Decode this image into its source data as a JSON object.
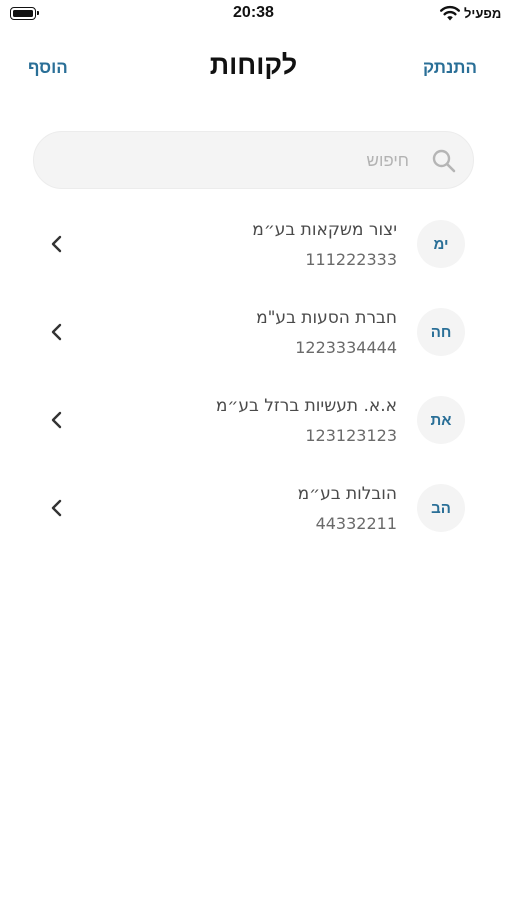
{
  "status_bar": {
    "time": "20:38",
    "carrier": "מפעיל",
    "wifi_icon": "wifi-icon",
    "battery_icon": "battery-icon"
  },
  "nav": {
    "title": "לקוחות",
    "left_action": "הוסף",
    "right_action": "התנתק"
  },
  "search": {
    "placeholder": "חיפוש",
    "value": "",
    "icon": "search-icon"
  },
  "clients": [
    {
      "initials": "ימ",
      "name": "יצור משקאות בע״מ",
      "id": "111222333"
    },
    {
      "initials": "חה",
      "name": "חברת הסעות בע\"מ",
      "id": "1223334444"
    },
    {
      "initials": "את",
      "name": "א.א. תעשיות ברזל בע״מ",
      "id": "123123123"
    },
    {
      "initials": "הב",
      "name": "הובלות בע״מ",
      "id": "44332211"
    }
  ],
  "colors": {
    "accent": "#2a6f97",
    "text_primary": "#111111",
    "text_secondary": "#6a6a6a",
    "avatar_bg": "#f4f4f4",
    "search_bg": "#f4f4f4"
  }
}
